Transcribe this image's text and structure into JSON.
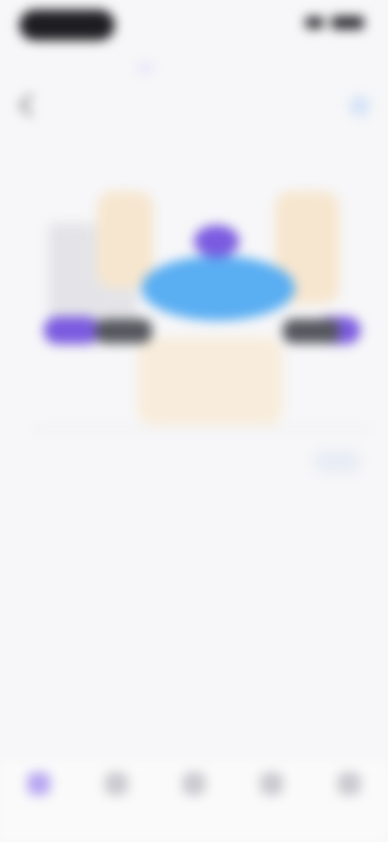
{
  "status": {
    "time": "",
    "battery_icon": "battery-icon",
    "signal_icon": "signal-icon"
  },
  "tabs": [
    {
      "label": ""
    },
    {
      "label": ""
    },
    {
      "label": ""
    },
    {
      "label": ""
    }
  ],
  "header": {
    "subtitle": "",
    "title": ""
  },
  "chart_data": {
    "type": "area",
    "title": "",
    "xlabel": "",
    "ylabel": "",
    "categories": [
      "",
      "",
      "",
      "",
      "",
      "",
      ""
    ],
    "series": [
      {
        "name": "",
        "values": []
      }
    ],
    "grid": false,
    "legend": ""
  },
  "chart_toggle": {
    "label": ""
  },
  "metrics_top": [
    {
      "label": "",
      "sub": ""
    },
    {
      "label": "",
      "sub": ""
    }
  ],
  "grid_row_1": [
    {
      "value": "",
      "label": ""
    },
    {
      "value": "",
      "label": ""
    },
    {
      "value": "",
      "label": ""
    }
  ],
  "grid_row_2": [
    {
      "value": "",
      "label": ""
    },
    {
      "value": "",
      "label": ""
    },
    {
      "value": "",
      "label": ""
    }
  ],
  "promos": [
    {
      "a": "",
      "b": "",
      "c": ""
    },
    {
      "a": "",
      "b": "",
      "c": ""
    }
  ],
  "bottom_nav": [
    {
      "label": "",
      "icon": "home-icon"
    },
    {
      "label": "",
      "icon": "calendar-icon"
    },
    {
      "label": "",
      "icon": "chart-icon"
    },
    {
      "label": "",
      "icon": "list-icon"
    },
    {
      "label": "",
      "icon": "profile-icon"
    }
  ],
  "colors": {
    "accent": "#7a63d8",
    "blue": "#3d7ee6",
    "band_blue": "#5aaef2",
    "band_purple": "#7b5be0",
    "band_dark": "#55575e",
    "peach": "#f6e3c8",
    "grey_block": "#e2e2e6"
  }
}
